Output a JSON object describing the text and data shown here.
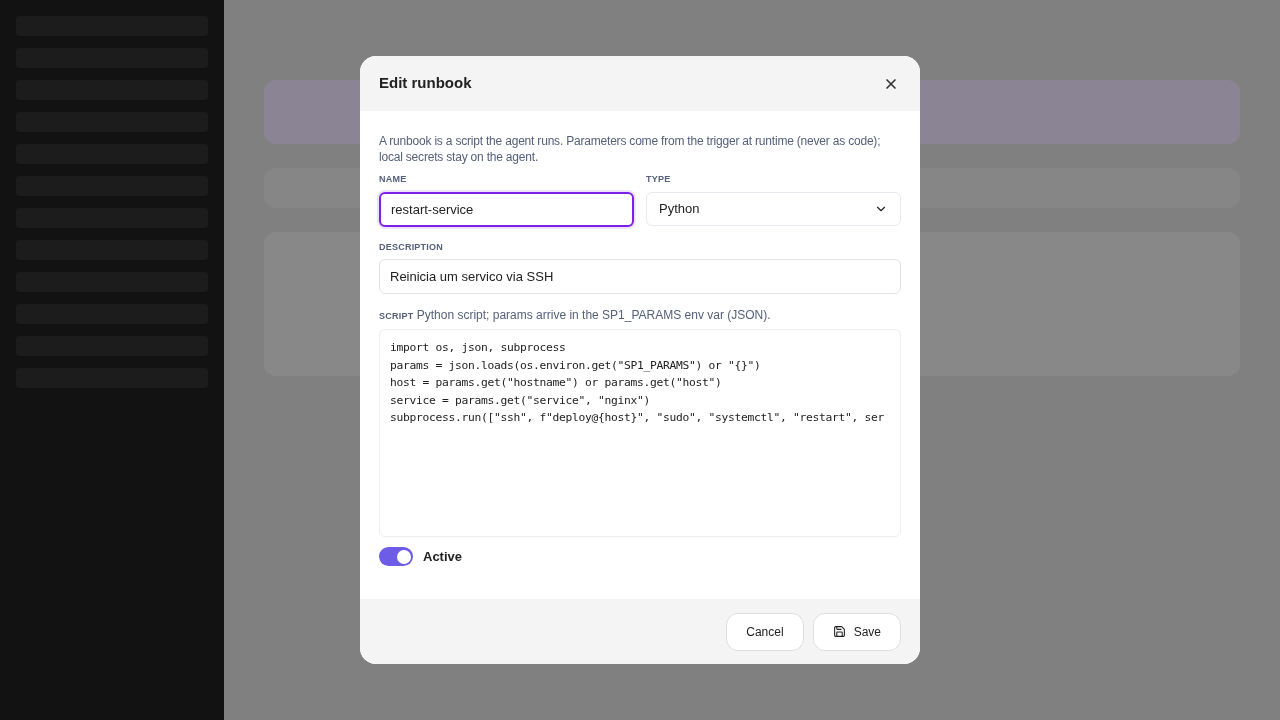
{
  "modal": {
    "title": "Edit runbook",
    "intro": "A runbook is a script the agent runs. Parameters come from the trigger at runtime (never as code); local secrets stay on the agent.",
    "name": {
      "label": "NAME",
      "value": "restart-service",
      "focused": true
    },
    "type": {
      "label": "TYPE",
      "value": "Python"
    },
    "description": {
      "label": "DESCRIPTION",
      "value": "Reinicia um servico via SSH"
    },
    "script": {
      "label": "SCRIPT",
      "hint": "Python script; params arrive in the SP1_PARAMS env var (JSON).",
      "lines": [
        "import os, json, subprocess",
        "params = json.loads(os.environ.get(\"SP1_PARAMS\") or \"{}\")",
        "host = params.get(\"hostname\") or params.get(\"host\")",
        "service = params.get(\"service\", \"nginx\")",
        "subprocess.run([\"ssh\", f\"deploy@{host}\", \"sudo\", \"systemctl\", \"restart\", ser"
      ]
    },
    "active": {
      "label": "Active",
      "on": true
    },
    "buttons": [
      {
        "kind": "cancel",
        "label": "Cancel"
      },
      {
        "kind": "save",
        "label": "Save"
      }
    ]
  }
}
